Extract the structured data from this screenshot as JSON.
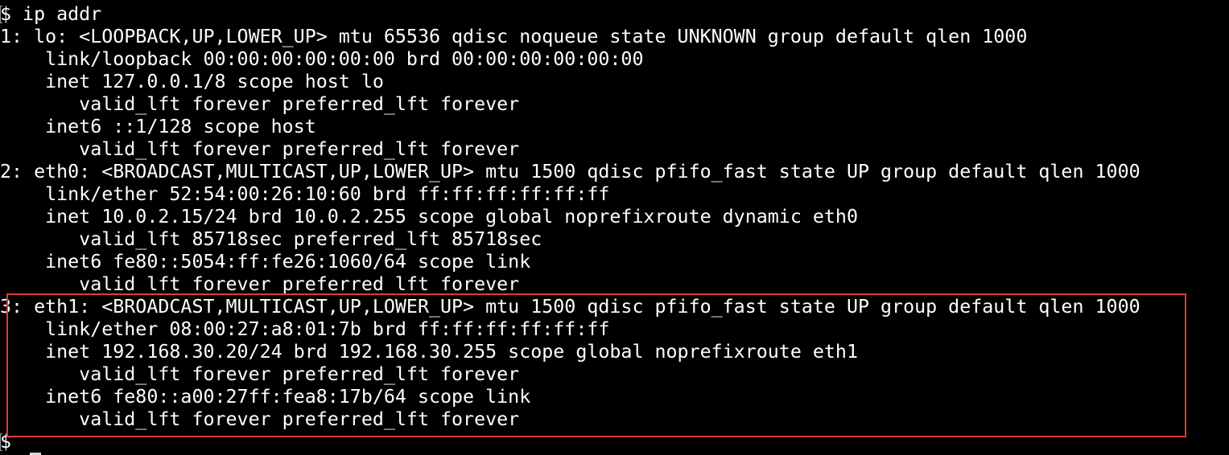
{
  "terminal": {
    "lines": [
      "$ ip addr",
      "1: lo: <LOOPBACK,UP,LOWER_UP> mtu 65536 qdisc noqueue state UNKNOWN group default qlen 1000",
      "    link/loopback 00:00:00:00:00:00 brd 00:00:00:00:00:00",
      "    inet 127.0.0.1/8 scope host lo",
      "       valid_lft forever preferred_lft forever",
      "    inet6 ::1/128 scope host",
      "       valid_lft forever preferred_lft forever",
      "2: eth0: <BROADCAST,MULTICAST,UP,LOWER_UP> mtu 1500 qdisc pfifo_fast state UP group default qlen 1000",
      "    link/ether 52:54:00:26:10:60 brd ff:ff:ff:ff:ff:ff",
      "    inet 10.0.2.15/24 brd 10.0.2.255 scope global noprefixroute dynamic eth0",
      "       valid_lft 85718sec preferred_lft 85718sec",
      "    inet6 fe80::5054:ff:fe26:1060/64 scope link",
      "       valid_lft forever preferred_lft forever",
      "3: eth1: <BROADCAST,MULTICAST,UP,LOWER_UP> mtu 1500 qdisc pfifo_fast state UP group default qlen 1000",
      "    link/ether 08:00:27:a8:01:7b brd ff:ff:ff:ff:ff:ff",
      "    inet 192.168.30.20/24 brd 192.168.30.255 scope global noprefixroute eth1",
      "       valid_lft forever preferred_lft forever",
      "    inet6 fe80::a00:27ff:fea8:17b/64 scope link",
      "       valid_lft forever preferred_lft forever",
      "$"
    ]
  },
  "colors": {
    "background": "#000000",
    "text": "#ffffff",
    "highlight_border": "#e03a36"
  }
}
